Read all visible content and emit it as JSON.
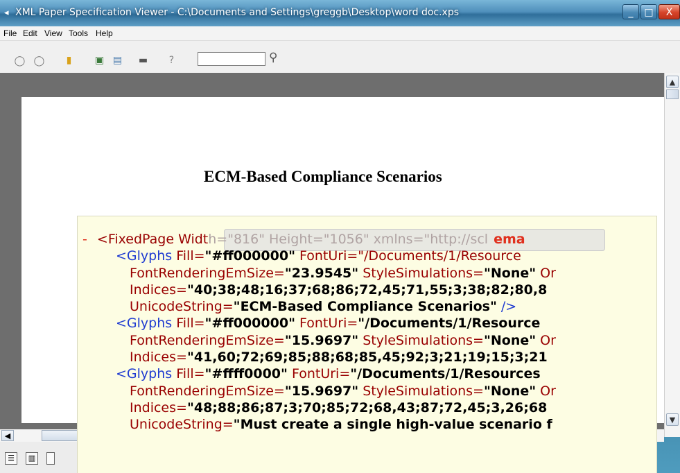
{
  "window": {
    "title": "XML Paper Specification Viewer - C:\\Documents and Settings\\greggb\\Desktop\\word doc.xps",
    "controls": {
      "minimize": "_",
      "maximize": "□",
      "close": "X"
    }
  },
  "menu": [
    "File",
    "Edit",
    "View",
    "Tools",
    "Help"
  ],
  "toolbar": {
    "icons": [
      "back-icon",
      "forward-icon",
      "open-folder-icon",
      "fit-page-icon",
      "export-icon",
      "print-icon",
      "help-icon"
    ],
    "search_value": ""
  },
  "document": {
    "heading": "ECM-Based Compliance Scenarios"
  },
  "xml": {
    "line1": {
      "minus": "-",
      "tag": "<FixedPage Widt",
      "hidden": "h=\"816\" Height=\"1056\" xmlns=\"http://scl",
      "tail": "ema"
    },
    "line2": {
      "text_open": "<Glyphs ",
      "attr": "Fill=",
      "val": "\"#ff000000\"",
      "rest": " FontUri=\"/Documents/1/Resource"
    },
    "line3": {
      "attr": "FontRenderingEmSize=",
      "val": "\"23.9545\"",
      "attr2": " StyleSimulations=",
      "val2": "\"None\"",
      "rest": " Or"
    },
    "line4": {
      "attr": "Indices=",
      "val": "\"40;38;48;16;37;68;86;72,45;71,55;3;38;82;80,8"
    },
    "line5": {
      "attr": "UnicodeString=",
      "val": "\"ECM-Based Compliance Scenarios\"",
      "rest": " />"
    },
    "line6": {
      "text_open": "<Glyphs ",
      "attr": "Fill=",
      "val": "\"#ff000000\"",
      "attr2": " FontUri=",
      "val2": "\"/Documents/1/Resource"
    },
    "line7": {
      "attr": "FontRenderingEmSize=",
      "val": "\"15.9697\"",
      "attr2": " StyleSimulations=",
      "val2": "\"None\"",
      "rest": " Or"
    },
    "line8": {
      "attr": "Indices=",
      "val": "\"41,60;72;69;85;88;68;85,45;92;3;21;19;15;3;21"
    },
    "line9": {
      "text_open": "<Glyphs ",
      "attr": "Fill=",
      "val": "\"#ffff0000\"",
      "attr2": " FontUri=",
      "val2": "\"/Documents/1/Resources"
    },
    "line10": {
      "attr": "FontRenderingEmSize=",
      "val": "\"15.9697\"",
      "attr2": " StyleSimulations=",
      "val2": "\"None\"",
      "rest": " Or"
    },
    "line11": {
      "attr": "Indices=",
      "val": "\"48;88;86;87;3;70;85;72;68,43;87;72,45;3,26;68"
    },
    "line12": {
      "attr": "UnicodeString=",
      "val": "\"Must create a single high-value scenario f"
    }
  }
}
